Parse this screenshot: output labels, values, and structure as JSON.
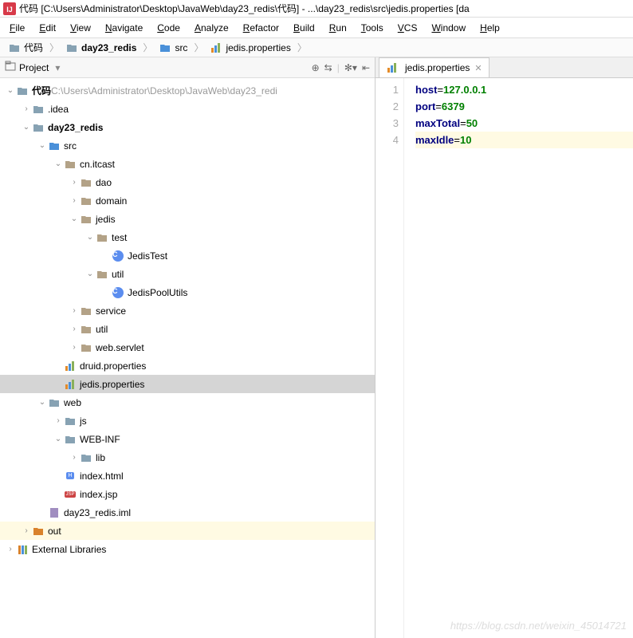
{
  "window_title": "代码 [C:\\Users\\Administrator\\Desktop\\JavaWeb\\day23_redis\\代码] - ...\\day23_redis\\src\\jedis.properties [da",
  "menu": [
    "File",
    "Edit",
    "View",
    "Navigate",
    "Code",
    "Analyze",
    "Refactor",
    "Build",
    "Run",
    "Tools",
    "VCS",
    "Window",
    "Help"
  ],
  "breadcrumb": [
    {
      "icon": "folder",
      "label": "代码"
    },
    {
      "icon": "folder",
      "label": "day23_redis",
      "bold": true
    },
    {
      "icon": "folder-src",
      "label": "src"
    },
    {
      "icon": "file-prop",
      "label": "jedis.properties"
    }
  ],
  "sidebar_title": "Project",
  "tree_root_path": "C:\\Users\\Administrator\\Desktop\\JavaWeb\\day23_redi",
  "tree": [
    {
      "d": 0,
      "a": "v",
      "i": "folder",
      "t": "代码",
      "suffix": "  C:\\Users\\Administrator\\Desktop\\JavaWeb\\day23_redi",
      "bold": true
    },
    {
      "d": 1,
      "a": ">",
      "i": "folder",
      "t": ".idea"
    },
    {
      "d": 1,
      "a": "v",
      "i": "folder",
      "t": "day23_redis",
      "bold": true
    },
    {
      "d": 2,
      "a": "v",
      "i": "folder-src",
      "t": "src"
    },
    {
      "d": 3,
      "a": "v",
      "i": "pkg",
      "t": "cn.itcast"
    },
    {
      "d": 4,
      "a": ">",
      "i": "pkg",
      "t": "dao"
    },
    {
      "d": 4,
      "a": ">",
      "i": "pkg",
      "t": "domain"
    },
    {
      "d": 4,
      "a": "v",
      "i": "pkg",
      "t": "jedis"
    },
    {
      "d": 5,
      "a": "v",
      "i": "pkg",
      "t": "test"
    },
    {
      "d": 6,
      "a": "",
      "i": "class",
      "t": "JedisTest"
    },
    {
      "d": 5,
      "a": "v",
      "i": "pkg",
      "t": "util"
    },
    {
      "d": 6,
      "a": "",
      "i": "class",
      "t": "JedisPoolUtils"
    },
    {
      "d": 4,
      "a": ">",
      "i": "pkg",
      "t": "service"
    },
    {
      "d": 4,
      "a": ">",
      "i": "pkg",
      "t": "util"
    },
    {
      "d": 4,
      "a": ">",
      "i": "pkg",
      "t": "web.servlet"
    },
    {
      "d": 3,
      "a": "",
      "i": "file-prop",
      "t": "druid.properties"
    },
    {
      "d": 3,
      "a": "",
      "i": "file-prop",
      "t": "jedis.properties",
      "sel": true
    },
    {
      "d": 2,
      "a": "v",
      "i": "folder",
      "t": "web"
    },
    {
      "d": 3,
      "a": ">",
      "i": "folder",
      "t": "js"
    },
    {
      "d": 3,
      "a": "v",
      "i": "folder",
      "t": "WEB-INF"
    },
    {
      "d": 4,
      "a": ">",
      "i": "folder",
      "t": "lib"
    },
    {
      "d": 3,
      "a": "",
      "i": "file-html",
      "t": "index.html"
    },
    {
      "d": 3,
      "a": "",
      "i": "file-jsp",
      "t": "index.jsp"
    },
    {
      "d": 2,
      "a": "",
      "i": "file-iml",
      "t": "day23_redis.iml"
    },
    {
      "d": 1,
      "a": ">",
      "i": "folder-out",
      "t": "out",
      "hl": true
    },
    {
      "d": 0,
      "a": ">",
      "i": "lib",
      "t": "External Libraries"
    }
  ],
  "tab_label": "jedis.properties",
  "code": [
    {
      "key": "host",
      "val": "127.0.0.1"
    },
    {
      "key": "port",
      "val": "6379"
    },
    {
      "key": "maxTotal",
      "val": "50"
    },
    {
      "key": "maxIdle",
      "val": "10"
    }
  ],
  "caret_line": 4,
  "watermark": "https://blog.csdn.net/weixin_45014721"
}
